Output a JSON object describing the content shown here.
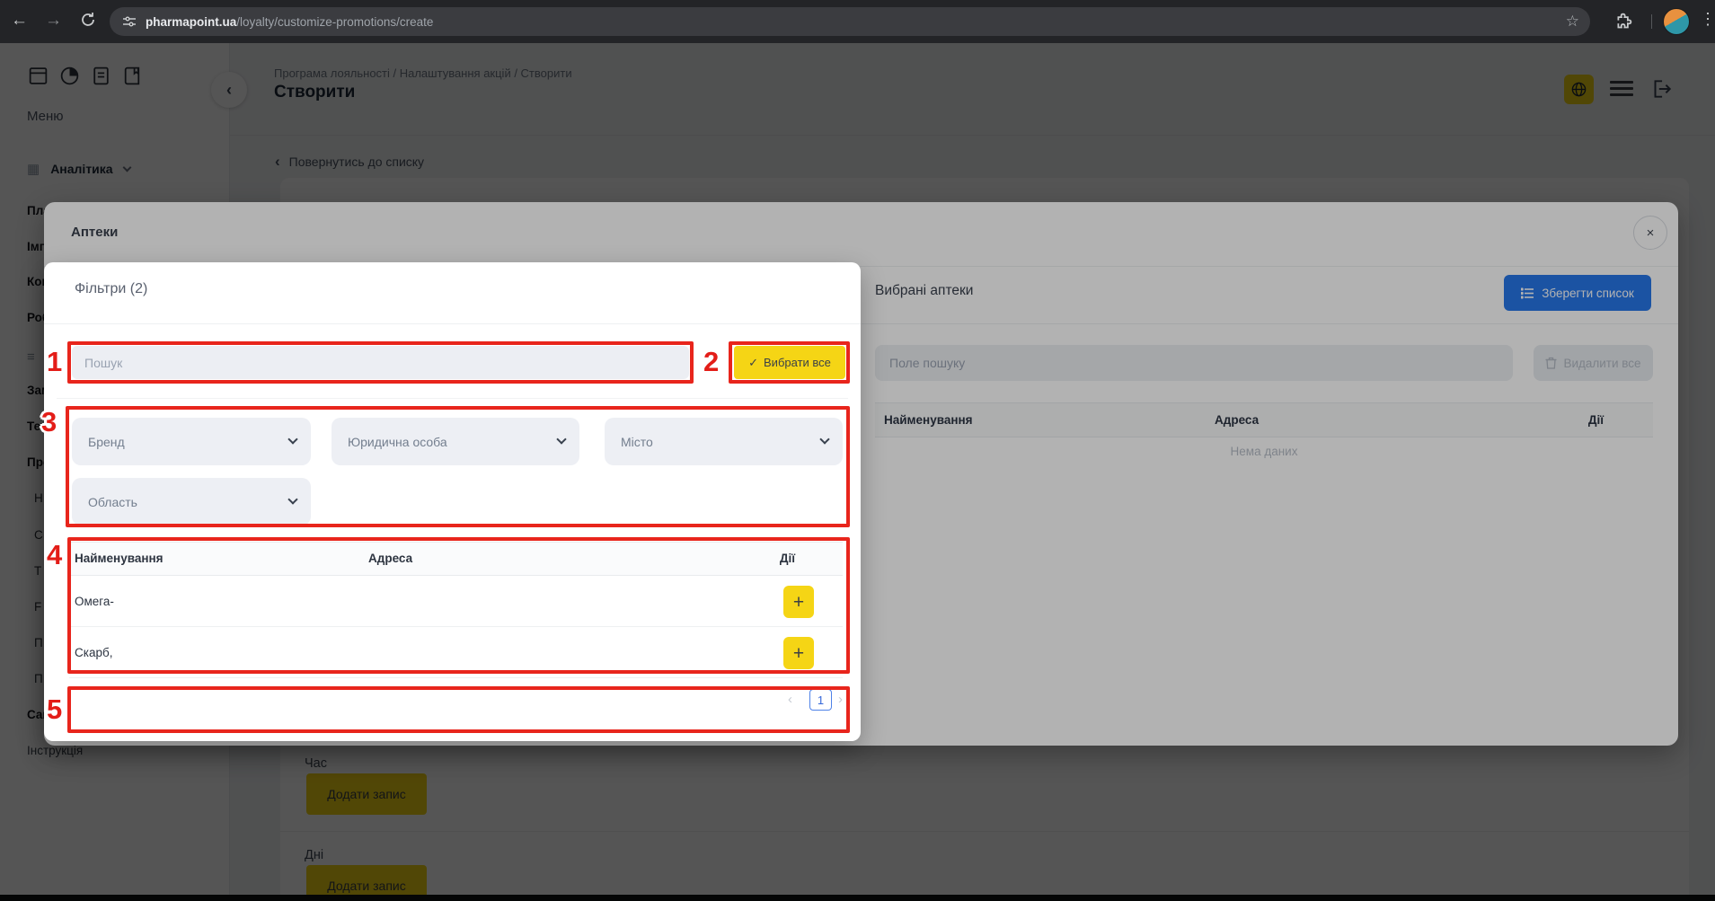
{
  "browser": {
    "url_domain": "pharmapoint.ua",
    "url_path": "/loyalty/customize-promotions/create"
  },
  "sidebar": {
    "menu_title": "Меню",
    "analytics_label": "Аналітика",
    "items": [
      "Пла",
      "Імп",
      "Кон",
      "Роб",
      "Зам",
      "Тех",
      "Про",
      "Н",
      "С",
      "Т",
      "F",
      "П",
      "П",
      "Сай",
      "Інструкція"
    ]
  },
  "header": {
    "breadcrumb": "Програма лояльності / Налаштування акцій / Створити",
    "title": "Створити",
    "back_to_list": "Повернутись до списку",
    "back_chevron": "‹"
  },
  "content": {
    "time_label": "Час",
    "days_label": "Дні",
    "add_record_label": "Додати запис"
  },
  "modal": {
    "title": "Аптеки",
    "close_glyph": "×",
    "selected": {
      "title": "Вибрані аптеки",
      "save_list_label": "Зберегти список",
      "search_placeholder": "Поле пошуку",
      "delete_all_label": "Видалити все",
      "columns": [
        "Найменування",
        "Адреса",
        "Дії"
      ],
      "empty_text": "Нема даних"
    }
  },
  "dialog": {
    "title": "Фільтри (2)",
    "search_placeholder": "Пошук",
    "select_all_label": "Вибрати все",
    "select_all_check": "✓",
    "filters": [
      "Бренд",
      "Юридична особа",
      "Місто",
      "Область"
    ],
    "columns": [
      "Найменування",
      "Адреса",
      "Дії"
    ],
    "rows": [
      {
        "name": "Омега-",
        "address": "",
        "action": "+"
      },
      {
        "name": "Скарб,",
        "address": "",
        "action": "+"
      }
    ],
    "pagination": {
      "prev": "‹",
      "current_page": "1",
      "next": "›"
    }
  },
  "annotations": {
    "labels": [
      "1",
      "2",
      "3",
      "4",
      "5"
    ]
  },
  "colors": {
    "brand_yellow": "#f5d515",
    "primary_blue": "#2878ea",
    "annotation_red": "#e8251c",
    "pagination_blue": "#3668d9"
  }
}
